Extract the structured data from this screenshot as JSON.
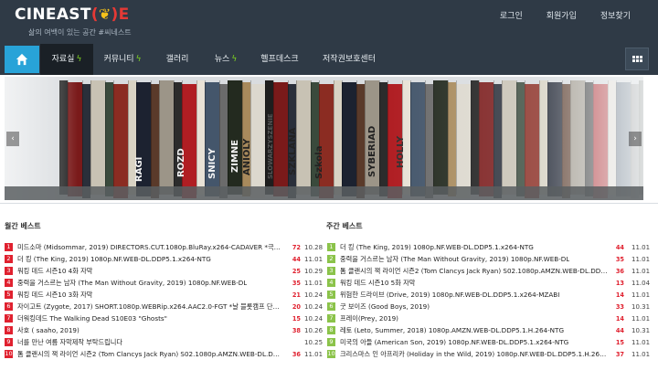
{
  "header": {
    "logo_text": "CINEAST",
    "logo_open": "(",
    "logo_leaf": "❦",
    "logo_close": ")E",
    "tagline": "삶의 여백이 있는 공간 #씨네스트",
    "links": [
      "로그인",
      "회원가입",
      "정보찾기"
    ]
  },
  "nav": {
    "home_icon": "home-icon",
    "items": [
      {
        "label": "자료실",
        "bolt": "ϟ"
      },
      {
        "label": "커뮤니티",
        "bolt": "ϟ"
      },
      {
        "label": "갤러리",
        "bolt": ""
      },
      {
        "label": "뉴스",
        "bolt": "ϟ"
      },
      {
        "label": "헬프데스크",
        "bolt": ""
      },
      {
        "label": "저작권보호센터",
        "bolt": ""
      }
    ],
    "grid_icon": "grid-menu-icon"
  },
  "banner": {
    "prev": "‹",
    "next": "›",
    "spine_texts": [
      "RAGI",
      "ROZD",
      "SNICY",
      "ZIMNE",
      "ANIOLY",
      "SZKLANA",
      "Szkola",
      "SYBERIAD",
      "HOLLY",
      "SLOWARZYSZENIE"
    ]
  },
  "monthly": {
    "title": "월간 베스트",
    "items": [
      {
        "rank": "1",
        "title": "미드소마 (Midsommar, 2019) DIRECTORS.CUT.1080p.BluRay.x264-CADAVER *극장판 포함*",
        "count": "72",
        "date": "10.28"
      },
      {
        "rank": "2",
        "title": "더 킹 (The King, 2019) 1080p.NF.WEB-DL.DDP5.1.x264-NTG",
        "count": "44",
        "date": "11.01"
      },
      {
        "rank": "3",
        "title": "워킹 데드 시즌10 4화 자막",
        "count": "25",
        "date": "10.29"
      },
      {
        "rank": "4",
        "title": "중력을 거스르는 남자 (The Man Without Gravity, 2019) 1080p.NF.WEB-DL",
        "count": "35",
        "date": "11.01"
      },
      {
        "rank": "5",
        "title": "워킹 데드 시즌10 3화 자막",
        "count": "21",
        "date": "10.24"
      },
      {
        "rank": "6",
        "title": "자이고트 (Zygote, 2017) SHORT.1080p.WEBRip.x264.AAC2.0-FGT *날 블롯캠프 단편 프로...",
        "count": "20",
        "date": "10.24"
      },
      {
        "rank": "7",
        "title": "더워킹데드 The Walking Dead S10E03 \"Ghosts\"",
        "count": "15",
        "date": "10.24"
      },
      {
        "rank": "8",
        "title": "사호 ( saaho, 2019)",
        "count": "38",
        "date": "10.26"
      },
      {
        "rank": "9",
        "title": "너를 만난 여름 자막제작 부탁드립니다",
        "count": "",
        "date": "10.25"
      },
      {
        "rank": "10",
        "title": "톰 클랜시의 잭 라이언 시즌2 (Tom Clancys Jack Ryan) S02.1080p.AMZN.WEB-DL.DDP5.1....",
        "count": "36",
        "date": "11.01"
      }
    ]
  },
  "weekly": {
    "title": "주간 베스트",
    "items": [
      {
        "rank": "1",
        "title": "더 킹 (The King, 2019) 1080p.NF.WEB-DL.DDP5.1.x264-NTG",
        "count": "44",
        "date": "11.01"
      },
      {
        "rank": "2",
        "title": "중력을 거스르는 남자 (The Man Without Gravity, 2019) 1080p.NF.WEB-DL",
        "count": "35",
        "date": "11.01"
      },
      {
        "rank": "3",
        "title": "톰 클랜시의 잭 라이언 시즌2 (Tom Clancys Jack Ryan) S02.1080p.AMZN.WEB-DL.DDP5.1...",
        "count": "36",
        "date": "11.01"
      },
      {
        "rank": "4",
        "title": "워킹 데드 시즌10 5화 자막",
        "count": "13",
        "date": "11.04"
      },
      {
        "rank": "5",
        "title": "위험한 드라이브 (Drive, 2019) 1080p.NF.WEB-DL.DDP5.1.x264-MZABI",
        "count": "14",
        "date": "11.01"
      },
      {
        "rank": "6",
        "title": "굿 보이즈 (Good Boys, 2019)",
        "count": "33",
        "date": "10.31"
      },
      {
        "rank": "7",
        "title": "프레이(Prey, 2019)",
        "count": "14",
        "date": "11.01"
      },
      {
        "rank": "8",
        "title": "레토 (Leto, Summer, 2018) 1080p.AMZN.WEB-DL.DDP5.1.H.264-NTG",
        "count": "44",
        "date": "10.31"
      },
      {
        "rank": "9",
        "title": "미국의 아들 (American Son, 2019) 1080p.NF.WEB-DL.DDP5.1.x264-NTG",
        "count": "15",
        "date": "11.01"
      },
      {
        "rank": "10",
        "title": "크리스마스 인 아프리카 (Holiday in the Wild, 2019) 1080p.NF.WEB-DL.DDP5.1.H.264-CM...",
        "count": "37",
        "date": "11.01"
      }
    ]
  },
  "colors": {
    "topbar": "#2f3a46",
    "accent_blue": "#28a3d8",
    "rank_red": "#e0212f",
    "rank_green": "#8bc34a",
    "bolt_green": "#7ed321"
  }
}
